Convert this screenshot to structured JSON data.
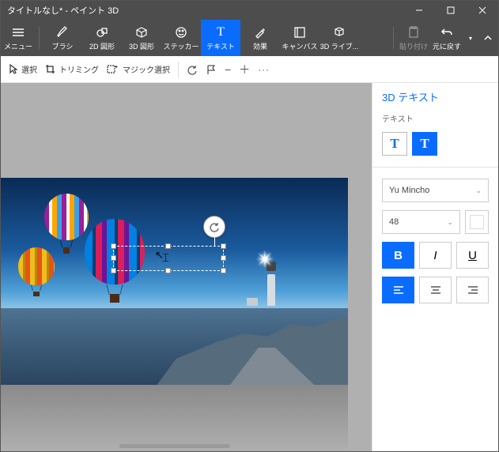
{
  "title": "タイトルなし* - ペイント 3D",
  "ribbon": {
    "menu": "メニュー",
    "brush": "ブラシ",
    "shape2d": "2D 図形",
    "shape3d": "3D 図形",
    "sticker": "ステッカー",
    "text": "テキスト",
    "effects": "効果",
    "canvas": "キャンバス",
    "lib3d": "3D ライブ...",
    "paste": "貼り付け",
    "undo": "元に戻す"
  },
  "toolrow": {
    "select": "選択",
    "trim": "トリミング",
    "magic": "マジック選択"
  },
  "panel": {
    "headline": "3D テキスト",
    "textLabel": "テキスト",
    "font": "Yu Mincho",
    "size": "48",
    "bold": "B",
    "italic": "I",
    "underline": "U",
    "color": "#ffffff"
  }
}
